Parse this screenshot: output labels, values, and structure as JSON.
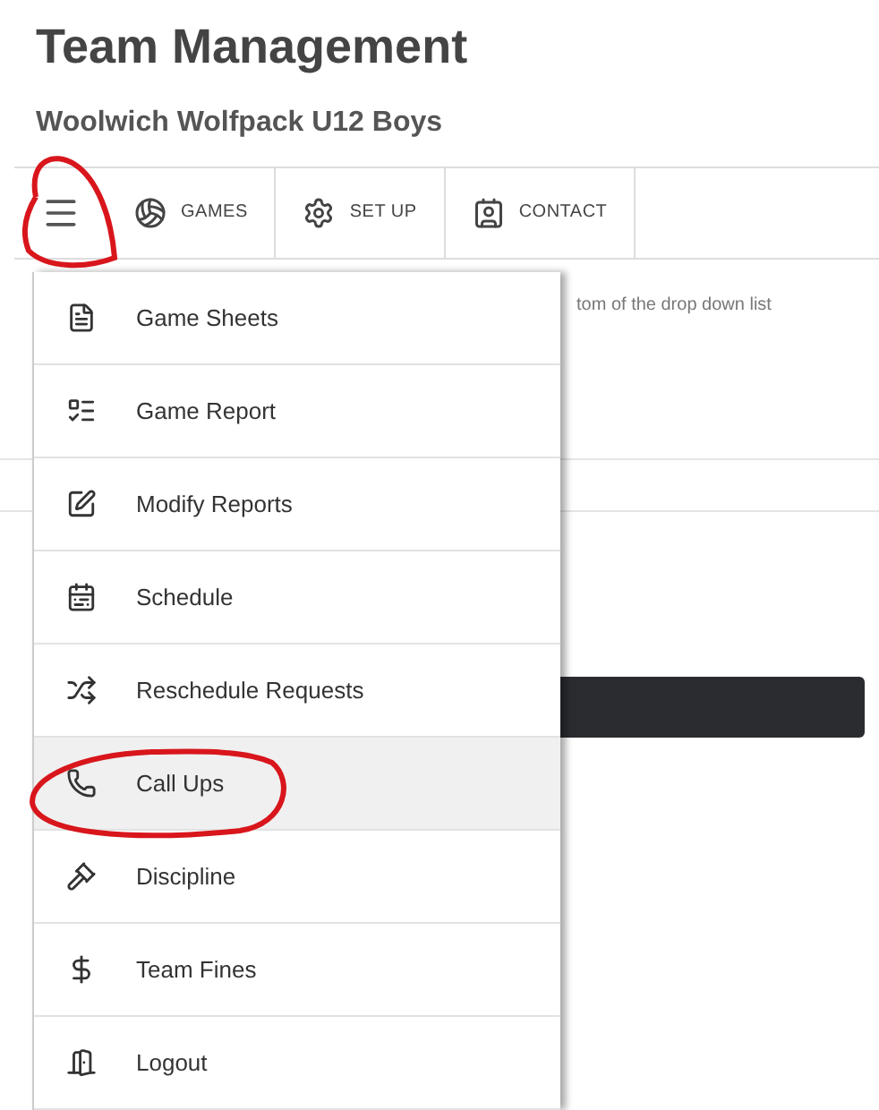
{
  "title": "Team Management",
  "subtitle": "Woolwich Wolfpack U12 Boys",
  "tabs": [
    {
      "label": "GAMES",
      "kind": "ball"
    },
    {
      "label": "SET UP",
      "kind": "gear"
    },
    {
      "label": "CONTACT",
      "kind": "contact"
    }
  ],
  "background_text": "tom of the drop down list",
  "menu": [
    {
      "label": "Game Sheets",
      "kind": "sheet",
      "selected": false
    },
    {
      "label": "Game Report",
      "kind": "report",
      "selected": false
    },
    {
      "label": "Modify Reports",
      "kind": "edit",
      "selected": false
    },
    {
      "label": "Schedule",
      "kind": "schedule",
      "selected": false
    },
    {
      "label": "Reschedule Requests",
      "kind": "shuffle",
      "selected": false
    },
    {
      "label": "Call Ups",
      "kind": "phone",
      "selected": true
    },
    {
      "label": "Discipline",
      "kind": "gavel",
      "selected": false
    },
    {
      "label": "Team Fines",
      "kind": "dollar",
      "selected": false
    },
    {
      "label": "Logout",
      "kind": "door",
      "selected": false
    }
  ]
}
